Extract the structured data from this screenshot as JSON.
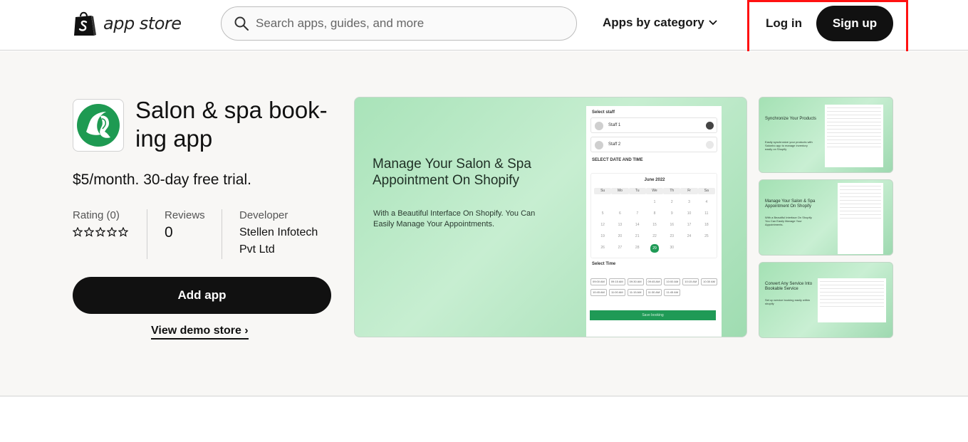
{
  "header": {
    "logo_text": "app store",
    "search_placeholder": "Search apps, guides, and more",
    "category_label": "Apps by category",
    "login_label": "Log in",
    "signup_label": "Sign up"
  },
  "app": {
    "title": "Salon & spa book-ing app",
    "pricing": "$5/month. 30-day free trial.",
    "rating_label": "Rating (0)",
    "rating_value": 0,
    "reviews_label": "Reviews",
    "reviews_value": "0",
    "developer_label": "Developer",
    "developer_name": "Stellen Infotech Pvt Ltd",
    "add_app_label": "Add app",
    "demo_link_label": "View demo store ›"
  },
  "screenshot_main": {
    "headline": "Manage Your Salon & Spa Appointment On Shopify",
    "subtext": "With a Beautiful Interface On Shopify. You Can Easily Manage Your Appointments.",
    "select_staff_label": "Select staff",
    "staff": [
      "Staff 1",
      "Staff 2"
    ],
    "select_date_label": "SELECT DATE AND TIME",
    "month": "June 2022",
    "weekdays": [
      "Su",
      "Mo",
      "Tu",
      "We",
      "Th",
      "Fr",
      "Sa"
    ],
    "days": [
      "",
      "",
      "",
      "1",
      "2",
      "3",
      "4",
      "5",
      "6",
      "7",
      "8",
      "9",
      "10",
      "11",
      "12",
      "13",
      "14",
      "15",
      "16",
      "17",
      "18",
      "19",
      "20",
      "21",
      "22",
      "23",
      "24",
      "25",
      "26",
      "27",
      "28",
      "29",
      "30",
      "",
      ""
    ],
    "selected_day": "29",
    "select_time_label": "Select Time",
    "times": [
      "09:00 AM",
      "09:15 AM",
      "09:30 AM",
      "09:45 AM",
      "10:00 AM",
      "10:15 AM",
      "10:30 AM",
      "10:45 AM",
      "11:00 AM",
      "11:15 AM",
      "11:30 AM",
      "11:45 AM"
    ],
    "save_label": "Save booking"
  },
  "thumbnails": [
    {
      "title": "Synchronize Your Products",
      "subtext": "Easily synchronize your products with Salonbo app to manage inventory easily on Shopify"
    },
    {
      "title": "Manage Your Salon & Spa Appointment On Shopify",
      "subtext": "With a Beautiful Interface On Shopify. You Can Easily Manage Your Appointments."
    },
    {
      "title": "Convert Any Service Into Bookable Service",
      "subtext": "Set up service booking easily within shopify"
    }
  ],
  "colors": {
    "accent_dark": "#111111",
    "brand_green": "#1f9a56",
    "highlight": "#ff1111"
  }
}
